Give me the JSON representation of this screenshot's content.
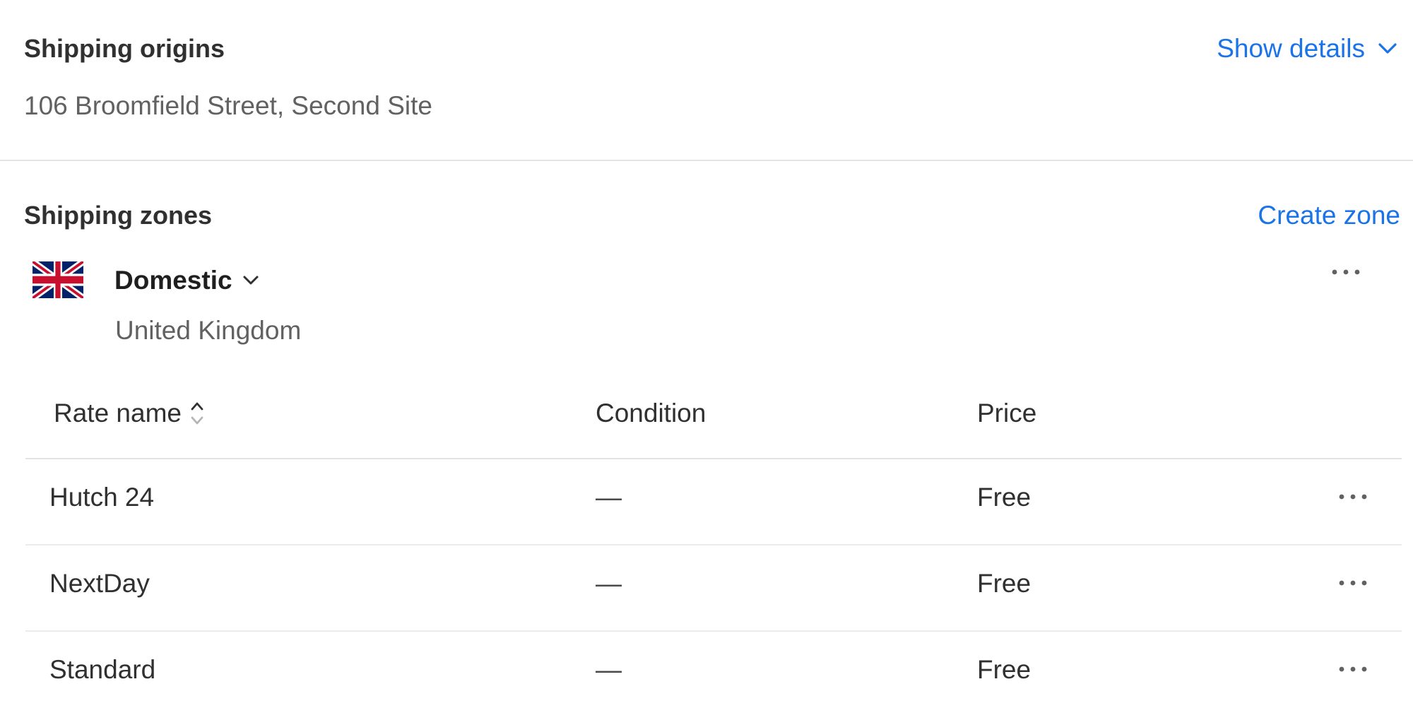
{
  "origins": {
    "title": "Shipping origins",
    "show_details_label": "Show details",
    "address": "106 Broomfield Street, Second Site"
  },
  "zones": {
    "title": "Shipping zones",
    "create_zone_label": "Create zone",
    "zone": {
      "name": "Domestic",
      "country": "United Kingdom",
      "flag_icon": "uk-flag-icon"
    },
    "table": {
      "headers": {
        "rate_name": "Rate name",
        "condition": "Condition",
        "price": "Price"
      },
      "rows": [
        {
          "name": "Hutch 24",
          "condition": "—",
          "price": "Free"
        },
        {
          "name": "NextDay",
          "condition": "—",
          "price": "Free"
        },
        {
          "name": "Standard",
          "condition": "—",
          "price": "Free"
        }
      ]
    }
  },
  "colors": {
    "link": "#1a73e8",
    "text": "#303030",
    "muted": "#616161",
    "divider": "#e3e3e3"
  }
}
